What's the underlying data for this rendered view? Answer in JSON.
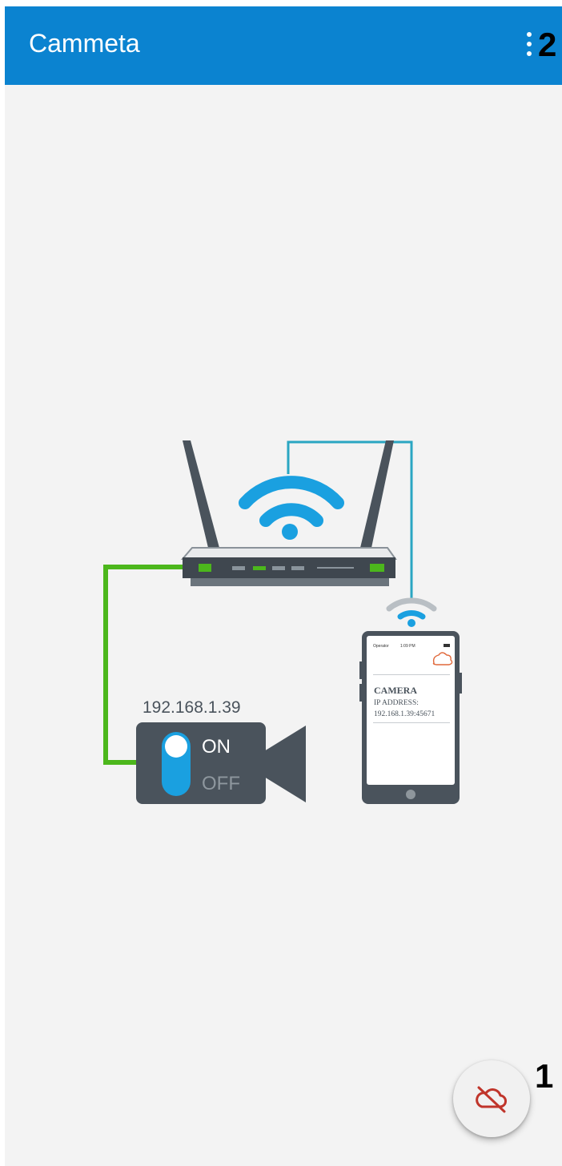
{
  "appbar": {
    "title": "Cammeta",
    "menu_icon": "more-vert-icon",
    "callout_number": "2"
  },
  "illustration": {
    "camera_ip_label": "192.168.1.39",
    "switch_on_label": "ON",
    "switch_off_label": "OFF",
    "phone": {
      "status_carrier": "Operator",
      "status_time": "1:09 PM",
      "cloud_icon": "cloud-icon",
      "heading": "CAMERA",
      "ip_label": "IP ADDRESS:",
      "ip_value": "192.168.1.39:45671"
    },
    "router_icon": "router-icon",
    "wifi_icon": "wifi-icon",
    "camera_icon": "video-camera-icon"
  },
  "fab": {
    "icon": "cloud-off-icon",
    "callout_number": "1"
  },
  "colors": {
    "appbar": "#0b83d0",
    "background": "#f3f3f3",
    "wifi": "#1aa0e0",
    "cable_green": "#4cb71c",
    "cable_teal": "#2aa6c2",
    "device_dark": "#4a535c",
    "cloud_off": "#c0352b"
  }
}
